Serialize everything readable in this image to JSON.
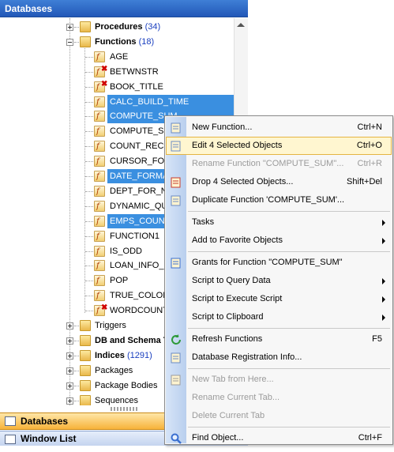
{
  "panel": {
    "title": "Databases"
  },
  "tree": [
    {
      "label": "Procedures",
      "count": "(34)",
      "kind": "group"
    },
    {
      "label": "Functions",
      "count": "(18)",
      "kind": "group-open"
    },
    {
      "label": "AGE",
      "kind": "fn"
    },
    {
      "label": "BETWNSTR",
      "kind": "fn-err"
    },
    {
      "label": "BOOK_TITLE",
      "kind": "fn-err"
    },
    {
      "label": "CALC_BUILD_TIME",
      "kind": "fn",
      "selected": true
    },
    {
      "label": "COMPUTE_SUM",
      "kind": "fn",
      "selected": true
    },
    {
      "label": "COMPUTE_SUM",
      "kind": "fn"
    },
    {
      "label": "COUNT_RECEN",
      "kind": "fn"
    },
    {
      "label": "CURSOR_FOR_",
      "kind": "fn"
    },
    {
      "label": "DATE_FORMAT",
      "kind": "fn",
      "selected": true
    },
    {
      "label": "DEPT_FOR_NA",
      "kind": "fn"
    },
    {
      "label": "DYNAMIC_QUE",
      "kind": "fn"
    },
    {
      "label": "EMPS_COUNT",
      "kind": "fn",
      "selected": true
    },
    {
      "label": "FUNCTION1",
      "kind": "fn"
    },
    {
      "label": "IS_ODD",
      "kind": "fn"
    },
    {
      "label": "LOAN_INFO_F",
      "kind": "fn"
    },
    {
      "label": "POP",
      "kind": "fn"
    },
    {
      "label": "TRUE_COLORS",
      "kind": "fn"
    },
    {
      "label": "WORDCOUNT",
      "kind": "fn-err"
    },
    {
      "label": "Triggers",
      "kind": "group"
    },
    {
      "label": "DB and Schema T",
      "kind": "group",
      "bold": true
    },
    {
      "label": "Indices",
      "count": "(1291)",
      "kind": "group",
      "bold": true
    },
    {
      "label": "Packages",
      "kind": "group"
    },
    {
      "label": "Package Bodies",
      "kind": "group"
    },
    {
      "label": "Sequences",
      "kind": "group"
    }
  ],
  "bottom": {
    "databases": "Databases",
    "window_list": "Window List"
  },
  "menu": {
    "items": [
      {
        "label": "New Function...",
        "shortcut": "Ctrl+N",
        "icon": "new-function-icon"
      },
      {
        "label": "Edit 4 Selected Objects",
        "shortcut": "Ctrl+O",
        "icon": "edit-objects-icon",
        "highlighted": true
      },
      {
        "label": "Rename Function \"COMPUTE_SUM\"...",
        "shortcut": "Ctrl+R",
        "disabled": true
      },
      {
        "label": "Drop 4 Selected Objects...",
        "shortcut": "Shift+Del",
        "icon": "drop-objects-icon"
      },
      {
        "label": "Duplicate Function 'COMPUTE_SUM'...",
        "shortcut": "",
        "icon": "duplicate-icon"
      },
      {
        "sep": true
      },
      {
        "label": "Tasks",
        "submenu": true
      },
      {
        "label": "Add to Favorite Objects",
        "submenu": true
      },
      {
        "sep": true
      },
      {
        "label": "Grants for Function \"COMPUTE_SUM\"",
        "icon": "grants-icon"
      },
      {
        "label": "Script to Query Data",
        "submenu": true
      },
      {
        "label": "Script to Execute Script",
        "submenu": true
      },
      {
        "label": "Script to Clipboard",
        "submenu": true
      },
      {
        "sep": true
      },
      {
        "label": "Refresh Functions",
        "shortcut": "F5",
        "icon": "refresh-icon"
      },
      {
        "label": "Database Registration Info...",
        "icon": "registration-info-icon"
      },
      {
        "sep": true
      },
      {
        "label": "New Tab from Here...",
        "disabled": true,
        "icon": "new-tab-icon"
      },
      {
        "label": "Rename Current Tab...",
        "disabled": true
      },
      {
        "label": "Delete Current Tab",
        "disabled": true
      },
      {
        "sep": true
      },
      {
        "label": "Find Object...",
        "shortcut": "Ctrl+F",
        "icon": "find-icon"
      }
    ]
  },
  "colors": {
    "header": "#2a64c2",
    "selection": "#3a8fe0",
    "highlight": "#fff6d0",
    "accent_bar": "#f7b23a"
  }
}
